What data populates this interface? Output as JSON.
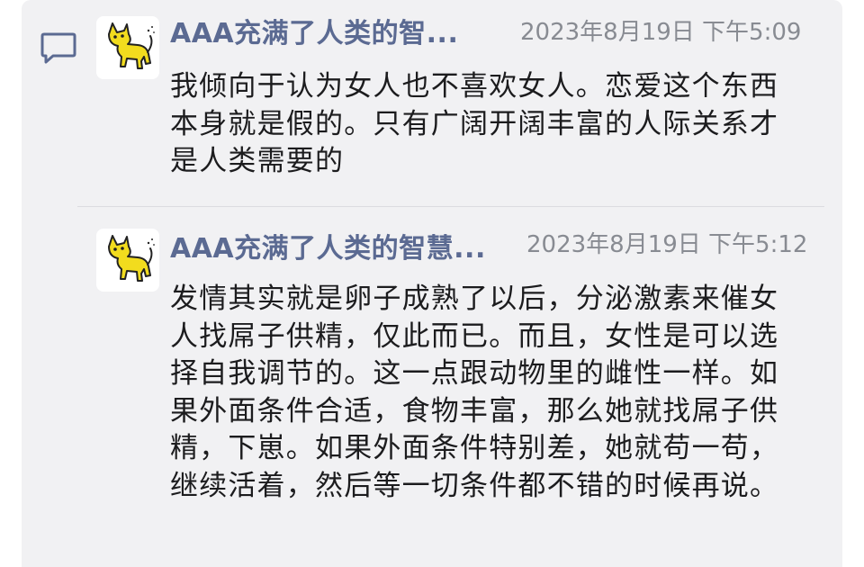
{
  "comments": [
    {
      "author": "AAA充满了人类的智...",
      "timestamp": "2023年8月19日 下午5:09",
      "text": "我倾向于认为女人也不喜欢女人。恋爱这个东西本身就是假的。只有广阔开阔丰富的人际关系才是人类需要的"
    },
    {
      "author": "AAA充满了人类的智慧...",
      "timestamp": "2023年8月19日 下午5:12",
      "text": "发情其实就是卵子成熟了以后，分泌激素来催女人找屌子供精，仅此而已。而且，女性是可以选择自我调节的。这一点跟动物里的雌性一样。如果外面条件合适，食物丰富，那么她就找屌子供精，下崽。如果外面条件特别差，她就苟一苟，继续活着，然后等一切条件都不错的时候再说。"
    }
  ],
  "icons": {
    "comment": "comment-bubble-icon",
    "avatar": "yellow-cat-avatar"
  },
  "colors": {
    "author_name": "#5b6a92",
    "timestamp": "#888b92",
    "text": "#1c1c1e",
    "card_background": "#f1f1f3",
    "avatar_cat": "#f2dc1e"
  }
}
